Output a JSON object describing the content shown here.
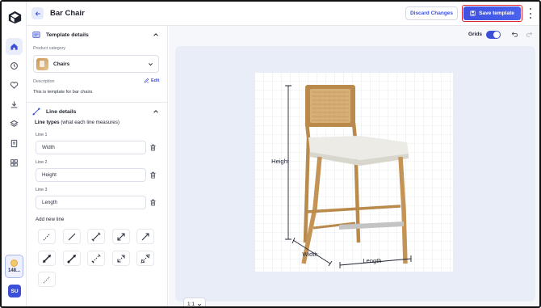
{
  "header": {
    "title": "Bar Chair",
    "discard_label": "Discard Changes",
    "save_label": "Save template"
  },
  "sidebar": {
    "items": [
      {
        "icon": "home-icon",
        "active": true
      },
      {
        "icon": "history-icon",
        "active": false
      },
      {
        "icon": "heart-icon",
        "active": false
      },
      {
        "icon": "download-icon",
        "active": false
      },
      {
        "icon": "layers-icon",
        "active": false
      },
      {
        "icon": "document-icon",
        "active": false
      },
      {
        "icon": "grid-icon",
        "active": false
      }
    ],
    "credits": "148...",
    "avatar_initials": "SU"
  },
  "template_details": {
    "heading": "Template details",
    "category_label": "Product category",
    "category_value": "Chairs",
    "description_label": "Description",
    "edit_label": "Edit",
    "description_text": "This is template for bar chairs"
  },
  "line_details": {
    "heading": "Line details",
    "types_title": "Line types",
    "types_hint": "(what each line measures)",
    "lines": [
      {
        "label": "Line 1",
        "value": "Width"
      },
      {
        "label": "Line 2",
        "value": "Height"
      },
      {
        "label": "Line 3",
        "value": "Length"
      }
    ],
    "add_new_label": "Add new line"
  },
  "canvas": {
    "grids_label": "Grids",
    "grids_on": true,
    "zoom_label": "1:1",
    "annotations": {
      "height": "Height",
      "width": "Width",
      "length": "Length"
    }
  },
  "colors": {
    "accent": "#3b4fd8",
    "highlight_border": "#e0202a",
    "canvas_bg": "#e8edf8"
  }
}
